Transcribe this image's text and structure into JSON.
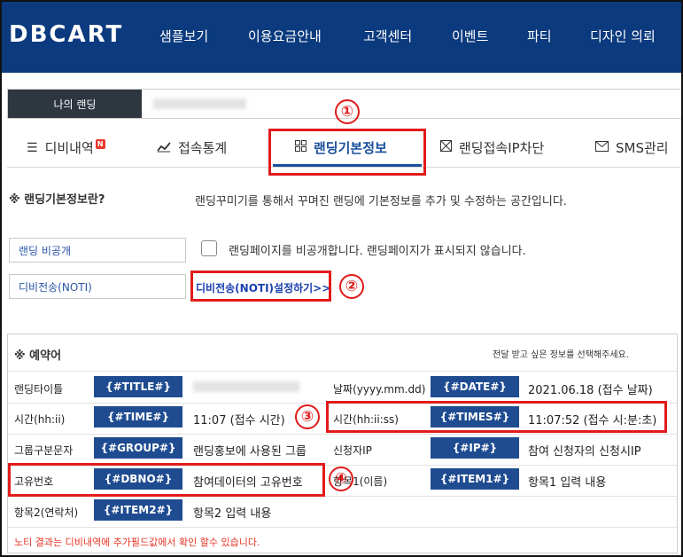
{
  "header": {
    "logo": "DBCART",
    "menu": [
      "샘플보기",
      "이용요금안내",
      "고객센터",
      "이벤트",
      "파티",
      "디자인 의뢰"
    ]
  },
  "landing_name": {
    "label": "나의 랜딩"
  },
  "tabs": [
    {
      "label": "디비내역",
      "badge": "N",
      "icon": "list-icon"
    },
    {
      "label": "접속통계",
      "icon": "chart-icon"
    },
    {
      "label": "랜딩기본정보",
      "icon": "grid-icon",
      "active": true
    },
    {
      "label": "랜딩접속IP차단",
      "icon": "block-icon"
    },
    {
      "label": "SMS관리",
      "icon": "mail-icon"
    }
  ],
  "info": {
    "title": "※ 랜딩기본정보란?",
    "description": "랜딩꾸미기를 통해서 꾸며진 랜딩에 기본정보를 추가 및 수정하는 공간입니다."
  },
  "private_setting": {
    "label": "랜딩 비공개",
    "description": "랜딩페이지를 비공개합니다. 랜딩페이지가 표시되지 않습니다."
  },
  "noti_setting": {
    "label": "디비전송(NOTI)",
    "link": "디비전송(NOTI)설정하기>>"
  },
  "reserved": {
    "title": "※ 예약어",
    "hint": "전달 받고 싶은 정보를 선택해주세요.",
    "rows": [
      [
        {
          "label": "랜딩타이틀",
          "tag": "{#TITLE#}",
          "value": ""
        },
        {
          "label": "날짜(yyyy.mm.dd)",
          "tag": "{#DATE#}",
          "value": "2021.06.18 (접수 날짜)"
        }
      ],
      [
        {
          "label": "시간(hh:ii)",
          "tag": "{#TIME#}",
          "value": "11:07 (접수 시간)"
        },
        {
          "label": "시간(hh:ii:ss)",
          "tag": "{#TIMES#}",
          "value": "11:07:52 (접수 시:분:초)"
        }
      ],
      [
        {
          "label": "그룹구분문자",
          "tag": "{#GROUP#}",
          "value": "랜딩홍보에 사용된 그룹"
        },
        {
          "label": "신청자IP",
          "tag": "{#IP#}",
          "value": "참여 신청자의 신청시IP"
        }
      ],
      [
        {
          "label": "고유번호",
          "tag": "{#DBNO#}",
          "value": "참여데이터의 고유번호"
        },
        {
          "label": "항목1(이름)",
          "tag": "{#ITEM1#}",
          "value": "항목1 입력 내용"
        }
      ],
      [
        {
          "label": "항목2(연락처)",
          "tag": "{#ITEM2#}",
          "value": "항목2 입력 내용"
        }
      ]
    ],
    "footnote": "노티 결과는 디비내역에 추가필드값에서 확인 할수 있습니다."
  },
  "annotations": [
    "①",
    "②",
    "③",
    "④"
  ],
  "colors": {
    "header_bg": "#0b3a7e",
    "tag_bg": "#1f4c91",
    "accent": "#1a4f9c",
    "annotation": "#e11b1b",
    "footnote": "#e53223"
  }
}
